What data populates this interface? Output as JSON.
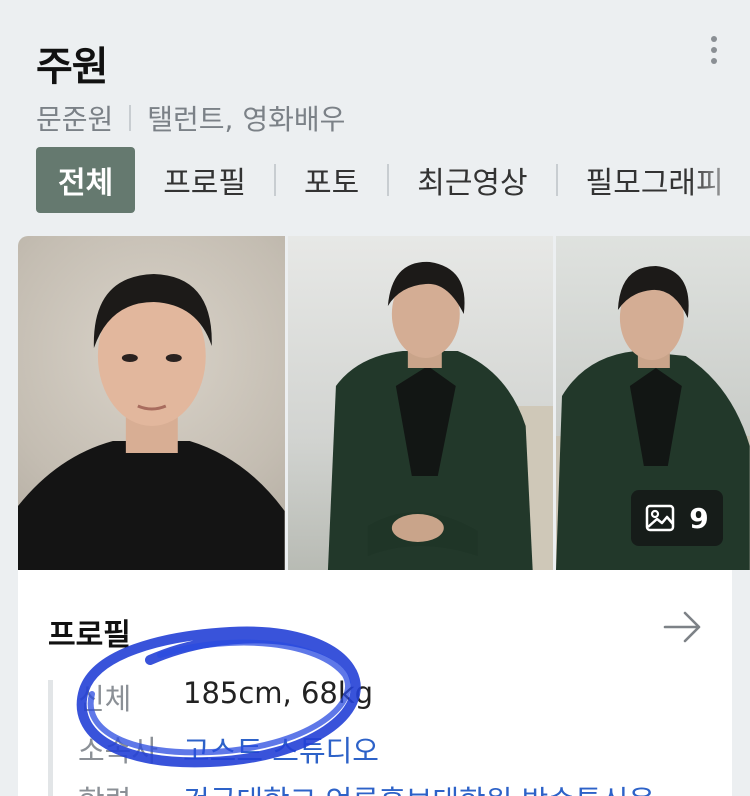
{
  "header": {
    "title": "주원",
    "real_name": "문준원",
    "occupation": "탤런트, 영화배우"
  },
  "tabs": [
    {
      "label": "전체",
      "active": true
    },
    {
      "label": "프로필",
      "active": false
    },
    {
      "label": "포토",
      "active": false
    },
    {
      "label": "최근영상",
      "active": false
    },
    {
      "label": "필모그래피",
      "active": false
    }
  ],
  "photos": {
    "count": "9",
    "icon": "image-gallery-icon"
  },
  "profile": {
    "title": "프로필",
    "rows": [
      {
        "label": "신체",
        "value": "185cm, 68kg"
      },
      {
        "label": "소속사",
        "value": "고스트 스튜디오"
      },
      {
        "label": "학력",
        "value": "건국대학교 언론홍보대학원 방송통신융"
      }
    ]
  },
  "colors": {
    "active_tab": "#65796f",
    "link": "#2d62c8",
    "annotation": "#2340d6"
  }
}
